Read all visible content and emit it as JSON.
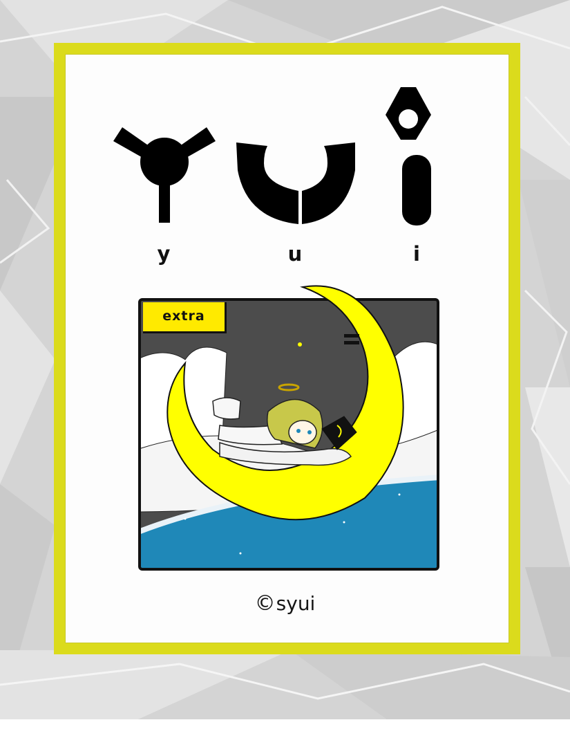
{
  "logo": {
    "letters": [
      "y",
      "u",
      "i"
    ]
  },
  "badge": {
    "label": "extra"
  },
  "credit": {
    "symbol": "©",
    "text": "syui"
  },
  "colors": {
    "frame": "#dbdb1c",
    "moon": "#ffff00",
    "sky": "#4c4c4c",
    "sea": "#1f88b8",
    "badge": "#ffea00",
    "backdrop": "#d9d9d9"
  }
}
